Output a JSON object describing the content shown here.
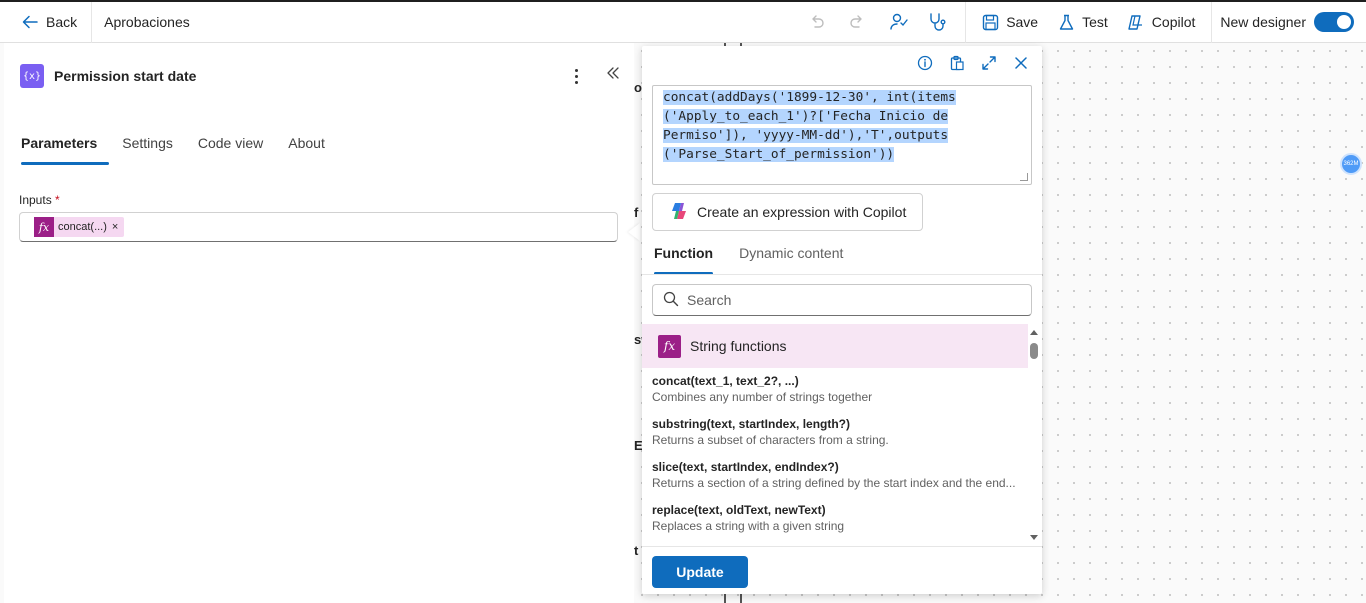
{
  "topbar": {
    "back_label": "Back",
    "flow_name": "Aprobaciones",
    "save_label": "Save",
    "test_label": "Test",
    "copilot_label": "Copilot",
    "new_designer_label": "New designer",
    "new_designer_on": true
  },
  "left_panel": {
    "title": "Permission start date",
    "logo_glyph": "{x}",
    "tabs": [
      {
        "label": "Parameters",
        "active": true
      },
      {
        "label": "Settings",
        "active": false
      },
      {
        "label": "Code view",
        "active": false
      },
      {
        "label": "About",
        "active": false
      }
    ],
    "inputs_label": "Inputs",
    "required_marker": "*",
    "token": {
      "icon": "fx",
      "label": "concat(...)",
      "remove": "×"
    }
  },
  "canvas": {
    "peek_texts": [
      "of",
      "f",
      "st",
      "Er",
      "t"
    ],
    "avatar_label": "362M"
  },
  "popup": {
    "expression_lines": [
      "concat(addDays('1899-12-30', int(items",
      "('Apply_to_each_1')?['Fecha Inicio de",
      "Permiso']), 'yyyy-MM-dd'),'T',outputs",
      "('Parse_Start_of_permission'))"
    ],
    "copilot_button_label": "Create an expression with Copilot",
    "tabs": [
      {
        "label": "Function",
        "active": true
      },
      {
        "label": "Dynamic content",
        "active": false
      }
    ],
    "search_placeholder": "Search",
    "category": {
      "icon": "fx",
      "label": "String functions"
    },
    "functions": [
      {
        "sig": "concat(text_1, text_2?, ...)",
        "desc": "Combines any number of strings together"
      },
      {
        "sig": "substring(text, startIndex, length?)",
        "desc": "Returns a subset of characters from a string."
      },
      {
        "sig": "slice(text, startIndex, endIndex?)",
        "desc": "Returns a section of a string defined by the start index and the end..."
      },
      {
        "sig": "replace(text, oldText, newText)",
        "desc": "Replaces a string with a given string"
      }
    ],
    "update_label": "Update"
  },
  "colors": {
    "accent": "#0f6cbd",
    "fx_magenta": "#9b1f87",
    "token_bg": "#f5d8f1",
    "category_bg": "#f7e6f4",
    "selection": "#b4d5fe",
    "logo_purple": "#7a5ff2"
  }
}
